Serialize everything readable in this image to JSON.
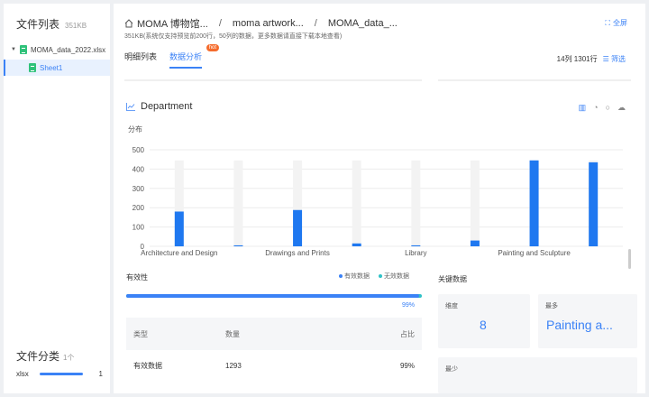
{
  "sidebar": {
    "title": "文件列表",
    "size": "351KB",
    "file_name": "MOMA_data_2022.xlsx",
    "sheet_name": "Sheet1",
    "category_title": "文件分类",
    "category_count": "1个",
    "category_ext": "xlsx",
    "category_num": "1"
  },
  "header": {
    "crumbs": [
      "MOMA 博物馆...",
      "moma artwork...",
      "MOMA_data_..."
    ],
    "fullscreen": "全屏",
    "subinfo": "351KB(系统仅支持预览前200行，50列的数据，更多数据请直接下载本地查看)",
    "tabs": [
      "明细列表",
      "数据分析"
    ],
    "hot_badge": "hot",
    "rowinfo": "14列 1301行",
    "filter": "筛选"
  },
  "dept": {
    "title": "Department",
    "dist_label": "分布"
  },
  "chart_data": {
    "type": "bar",
    "categories": [
      "Architecture and Design",
      "",
      "Drawings and Prints",
      "",
      "Library",
      "",
      "Painting and Sculpture",
      ""
    ],
    "tick_labels": [
      "Architecture and Design",
      "Drawings and Prints",
      "Library",
      "Painting and Sculpture"
    ],
    "values": [
      180,
      5,
      188,
      15,
      5,
      30,
      445,
      435
    ],
    "background_max": 445,
    "yticks": [
      0,
      100,
      200,
      300,
      400,
      500
    ],
    "ylim": [
      0,
      500
    ],
    "grid": true,
    "bar_color": "#1f78f0",
    "track_color": "#f3f3f3"
  },
  "validity": {
    "title": "有效性",
    "legend_valid": "有效数据",
    "legend_invalid": "无效数据",
    "valid_color": "#3b82f6",
    "invalid_color": "#2fc2c7",
    "percent_value": 99,
    "percent_label": "99%",
    "headers": [
      "类型",
      "数量",
      "占比"
    ],
    "rows": [
      {
        "type": "有效数据",
        "count": "1293",
        "pct": "99%"
      }
    ]
  },
  "key_data": {
    "title": "关键数据",
    "dim_label": "维度",
    "dim_value": "8",
    "most_label": "最多",
    "most_value": "Painting a...",
    "least_label": "最少"
  }
}
